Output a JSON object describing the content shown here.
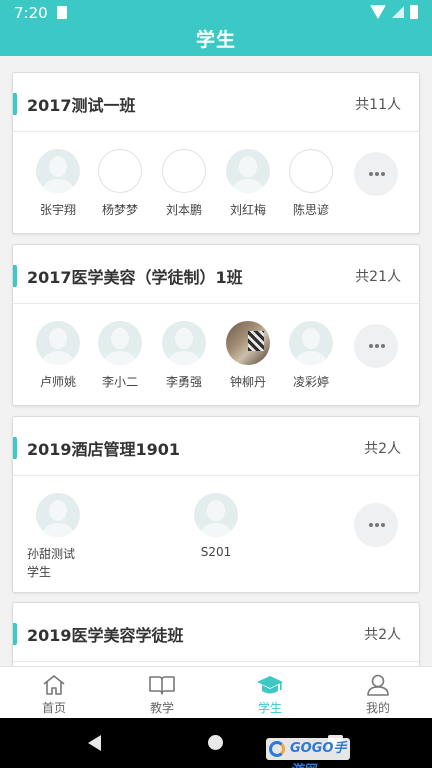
{
  "status_bar": {
    "time": "7:20"
  },
  "header": {
    "title": "学生"
  },
  "accent_color": "#3cc9c6",
  "classes": [
    {
      "name": "2017测试一班",
      "count": "共11人",
      "students": [
        {
          "name": "张宇翔",
          "avatar": "silhouette"
        },
        {
          "name": "杨梦梦",
          "avatar": "blank"
        },
        {
          "name": "刘本鹏",
          "avatar": "blank"
        },
        {
          "name": "刘红梅",
          "avatar": "silhouette"
        },
        {
          "name": "陈思谚",
          "avatar": "blank"
        }
      ]
    },
    {
      "name": "2017医学美容（学徒制）1班",
      "count": "共21人",
      "students": [
        {
          "name": "卢师姚",
          "avatar": "silhouette"
        },
        {
          "name": "李小二",
          "avatar": "silhouette"
        },
        {
          "name": "李勇强",
          "avatar": "silhouette"
        },
        {
          "name": "钟柳丹",
          "avatar": "photo"
        },
        {
          "name": "凌彩婷",
          "avatar": "silhouette"
        }
      ]
    },
    {
      "name": "2019酒店管理1901",
      "count": "共2人",
      "students": [
        {
          "name": "孙甜测试学生",
          "line1": "孙甜测试",
          "line2": "学生",
          "avatar": "silhouette"
        },
        {
          "name": "S201",
          "avatar": "silhouette"
        }
      ]
    },
    {
      "name": "2019医学美容学徒班",
      "count": "共2人",
      "students": []
    }
  ],
  "tabs": [
    {
      "label": "首页",
      "icon": "home-icon",
      "active": false
    },
    {
      "label": "教学",
      "icon": "book-icon",
      "active": false
    },
    {
      "label": "学生",
      "icon": "graduation-cap-icon",
      "active": true
    },
    {
      "label": "我的",
      "icon": "user-icon",
      "active": false
    }
  ],
  "watermark": "GOGO手游网"
}
